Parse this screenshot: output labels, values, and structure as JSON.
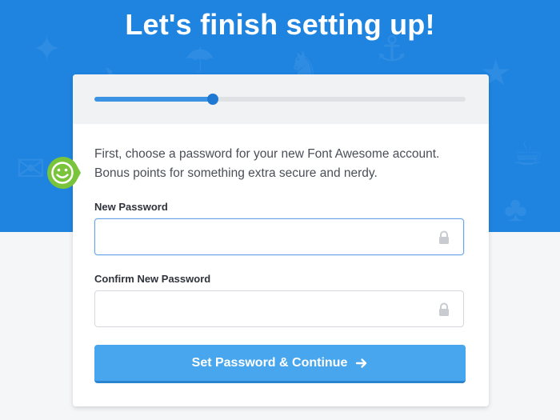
{
  "hero": {
    "title": "Let's finish setting up!",
    "background_color": "#1f84e0"
  },
  "progress": {
    "fraction": 0.32,
    "track_color": "#dfe1e5",
    "fill_color": "#3d93e3",
    "knob_color": "#1f78d1"
  },
  "intro": {
    "line1": "First, choose a password for your new Font Awesome account.",
    "line2": "Bonus points for something extra secure and nerdy.",
    "badge_icon": "smiley-badge-icon",
    "badge_color": "#7ac43b"
  },
  "form": {
    "new_password": {
      "label": "New Password",
      "value": "",
      "placeholder": "",
      "icon": "lock-icon"
    },
    "confirm_password": {
      "label": "Confirm New Password",
      "value": "",
      "placeholder": "",
      "icon": "lock-icon"
    },
    "submit": {
      "label": "Set Password & Continue",
      "icon": "arrow-right-icon",
      "color": "#48a6ee"
    }
  }
}
